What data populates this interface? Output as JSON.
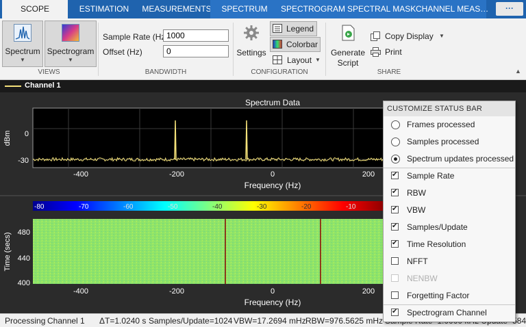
{
  "tabs": [
    {
      "label": "SCOPE",
      "active": true
    },
    {
      "label": "ESTIMATION"
    },
    {
      "label": "MEASUREMENTS"
    },
    {
      "label": "SPECTRUM"
    },
    {
      "label": "SPECTROGRAM"
    },
    {
      "label": "SPECTRAL MASK"
    },
    {
      "label": "CHANNEL MEAS…"
    }
  ],
  "tab_more_label": "···",
  "ribbon": {
    "views": {
      "label": "VIEWS",
      "spectrum_label": "Spectrum",
      "spectrogram_label": "Spectrogram"
    },
    "bandwidth": {
      "label": "BANDWIDTH",
      "sample_rate_label": "Sample Rate (Hz)",
      "sample_rate_value": "1000",
      "offset_label": "Offset (Hz)",
      "offset_value": "0"
    },
    "configuration": {
      "label": "CONFIGURATION",
      "settings_label": "Settings",
      "legend_label": "Legend",
      "colorbar_label": "Colorbar",
      "layout_label": "Layout"
    },
    "share": {
      "label": "SHARE",
      "generate_script_line1": "Generate",
      "generate_script_line2": "Script",
      "copy_display_label": "Copy Display",
      "print_label": "Print"
    }
  },
  "legend_bar": {
    "channel_label": "Channel 1"
  },
  "spectrum_plot": {
    "title": "Spectrum Data",
    "ylabel": "dBm",
    "xlabel": "Frequency (Hz)",
    "yticks": [
      "0",
      "-30"
    ],
    "xticks": [
      "-400",
      "-200",
      "0",
      "200"
    ]
  },
  "colorbar": {
    "ticks": [
      "-80",
      "-70",
      "-60",
      "-50",
      "-40",
      "-30",
      "-20",
      "-10"
    ]
  },
  "spectrogram_plot": {
    "ylabel": "Time (secs)",
    "xlabel": "Frequency (Hz)",
    "yticks": [
      "480",
      "440",
      "400"
    ],
    "xticks": [
      "-400",
      "-200",
      "0",
      "200"
    ]
  },
  "chart_data": {
    "type": "line",
    "title": "Spectrum Data",
    "xlabel": "Frequency (Hz)",
    "ylabel": "dBm",
    "xlim": [
      -500,
      500
    ],
    "ylim": [
      -38,
      20
    ],
    "noise_floor": -30,
    "peaks": [
      {
        "x": -100,
        "y": 8
      },
      {
        "x": 100,
        "y": 8
      }
    ],
    "series": [
      {
        "name": "Channel 1",
        "color": "#f5e27a"
      }
    ]
  },
  "status_bar": {
    "state": "Processing",
    "channel": "Channel 1",
    "delta_t": "ΔT=1.0240 s",
    "samples_update": "Samples/Update=1024",
    "vbw": "VBW=17.2694 mHz",
    "rbw": "RBW=976.5625 mHz",
    "extra": "Sample Rate=1.0000 kHz  Update=584"
  },
  "popup": {
    "title": "CUSTOMIZE STATUS BAR",
    "radios": [
      {
        "label": "Frames processed",
        "selected": false
      },
      {
        "label": "Samples processed",
        "selected": false
      },
      {
        "label": "Spectrum updates processed",
        "selected": true
      }
    ],
    "checks": [
      {
        "label": "Sample Rate",
        "checked": true,
        "disabled": false
      },
      {
        "label": "RBW",
        "checked": true,
        "disabled": false
      },
      {
        "label": "VBW",
        "checked": true,
        "disabled": false
      },
      {
        "label": "Samples/Update",
        "checked": true,
        "disabled": false
      },
      {
        "label": "Time Resolution",
        "checked": true,
        "disabled": false
      },
      {
        "label": "NFFT",
        "checked": false,
        "disabled": false
      },
      {
        "label": "NENBW",
        "checked": false,
        "disabled": true
      },
      {
        "label": "Forgetting Factor",
        "checked": false,
        "disabled": false
      }
    ],
    "channel_check": {
      "label": "Spectrogram Channel",
      "checked": true
    }
  },
  "colors": {
    "accent": "#1f63ae",
    "trace": "#f5e27a",
    "plot_bg": "#000000",
    "figure_bg": "#2b2b2b"
  }
}
